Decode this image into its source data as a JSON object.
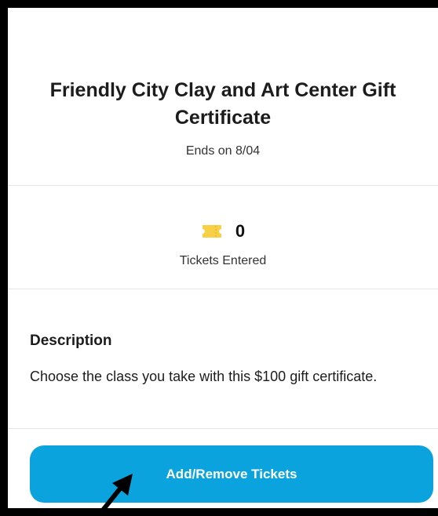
{
  "gift": {
    "title": "Friendly City Clay and Art Center Gift Certificate",
    "ends": "Ends on 8/04"
  },
  "tickets": {
    "icon": "ticket-icon",
    "icon_color": "#f7d046",
    "count": "0",
    "label": "Tickets Entered"
  },
  "description": {
    "heading": "Description",
    "text": "Choose the class you take with this $100 gift certificate."
  },
  "action": {
    "label": "Add/Remove Tickets",
    "color": "#0aa3dd"
  },
  "annotation": {
    "icon": "pointer-arrow-icon",
    "color": "#000000"
  }
}
